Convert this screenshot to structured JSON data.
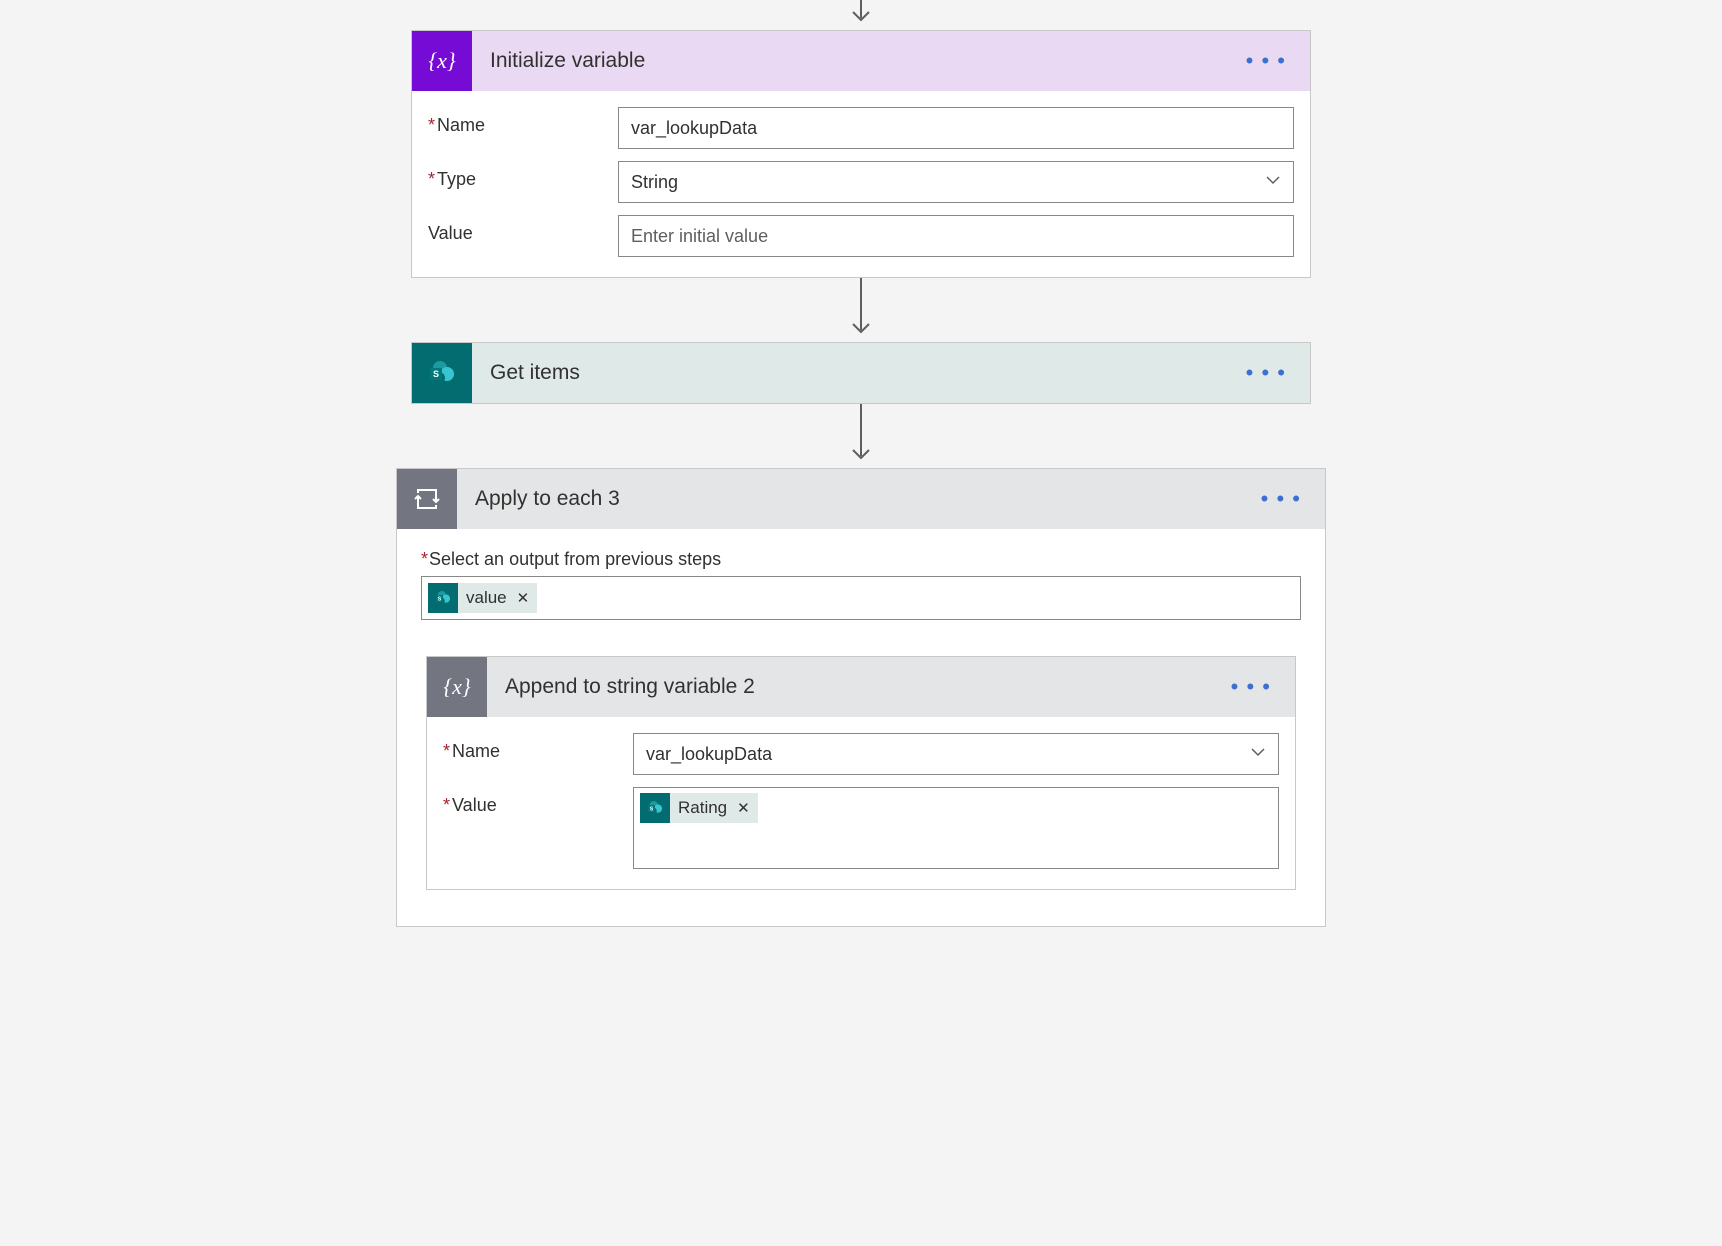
{
  "connector": {
    "icon_name": "arrow-down"
  },
  "step1": {
    "title": "Initialize variable",
    "icon": "variable-icon",
    "fields": {
      "name_label": "Name",
      "name_value": "var_lookupData",
      "type_label": "Type",
      "type_value": "String",
      "value_label": "Value",
      "value_placeholder": "Enter initial value"
    }
  },
  "step2": {
    "title": "Get items",
    "icon": "sharepoint-icon"
  },
  "step3": {
    "title": "Apply to each 3",
    "icon": "loop-icon",
    "select_label": "Select an output from previous steps",
    "select_token": {
      "label": "value",
      "source_icon": "sharepoint-icon"
    },
    "inner": {
      "title": "Append to string variable 2",
      "icon": "variable-icon",
      "fields": {
        "name_label": "Name",
        "name_value": "var_lookupData",
        "value_label": "Value",
        "value_token": {
          "label": "Rating",
          "source_icon": "sharepoint-icon"
        }
      }
    }
  },
  "ui": {
    "more_menu": "•  •  •",
    "remove_token": "✕"
  }
}
